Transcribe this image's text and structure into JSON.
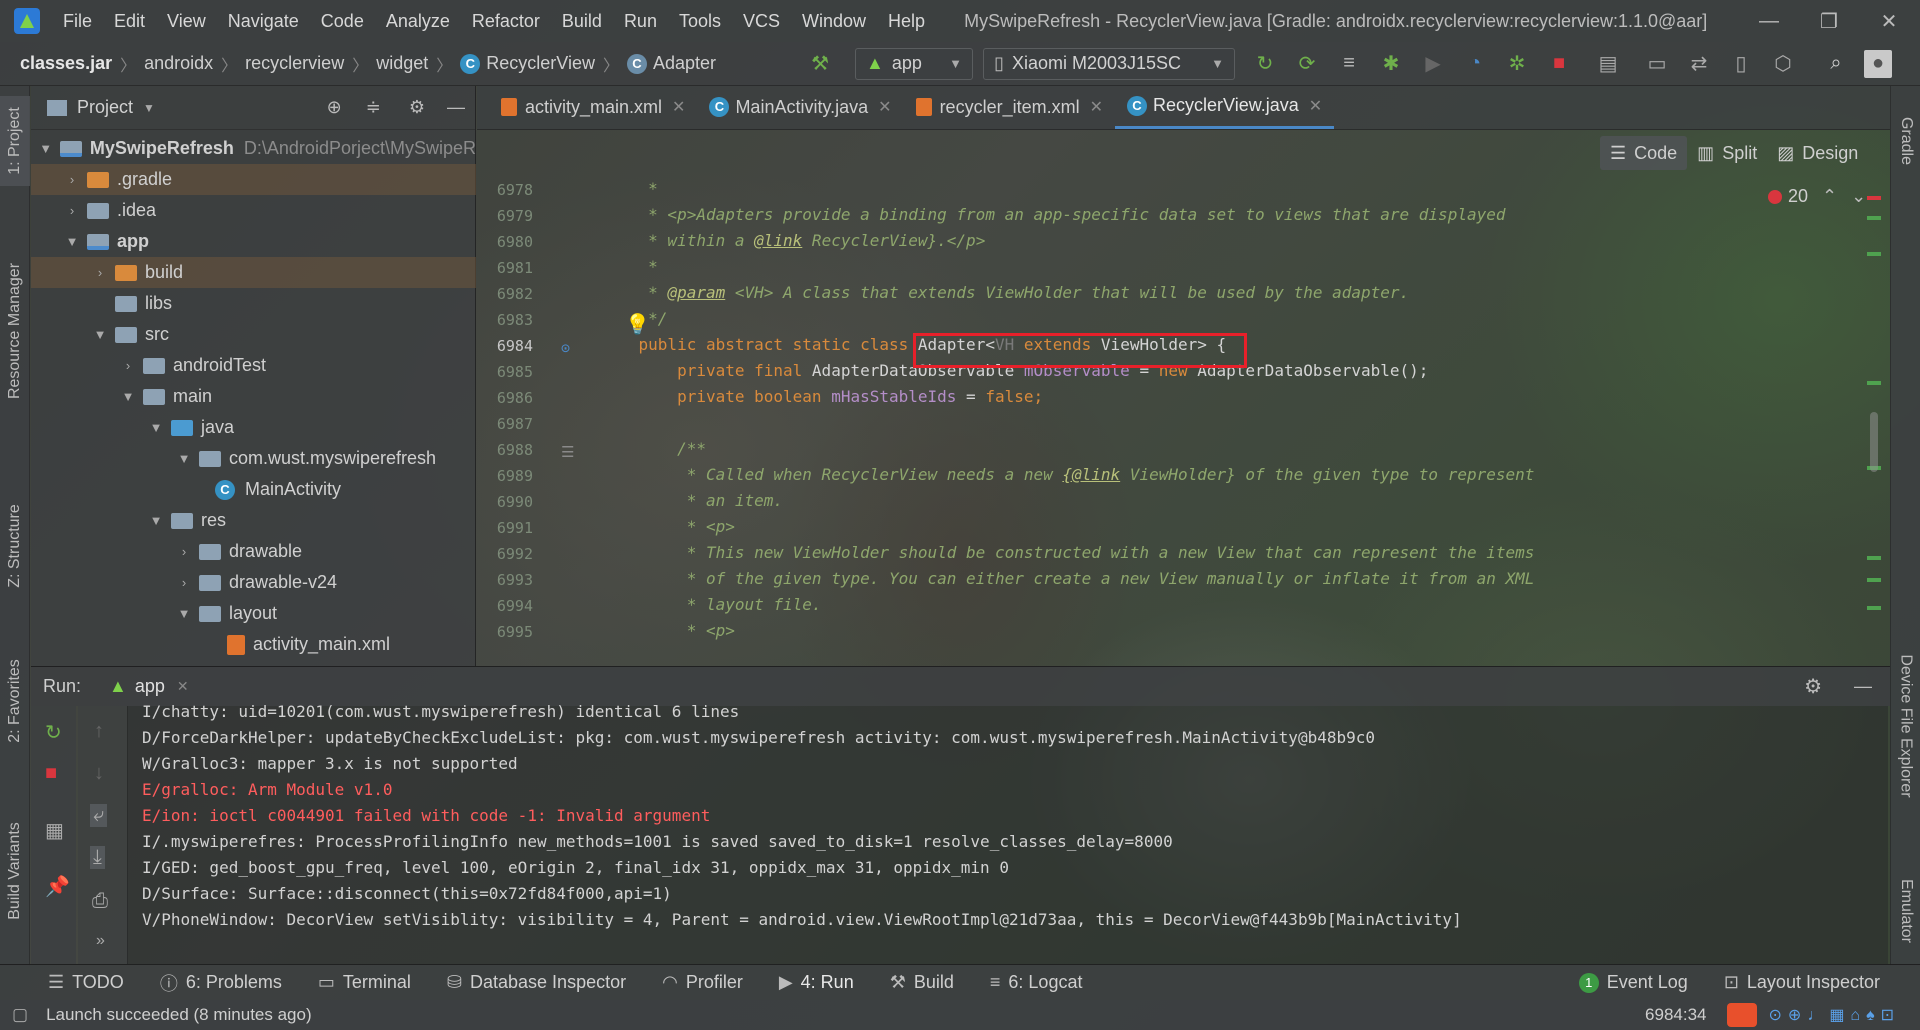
{
  "menu": [
    "File",
    "Edit",
    "View",
    "Navigate",
    "Code",
    "Analyze",
    "Refactor",
    "Build",
    "Run",
    "Tools",
    "VCS",
    "Window",
    "Help"
  ],
  "window_title": "MySwipeRefresh - RecyclerView.java [Gradle: androidx.recyclerview:recyclerview:1.1.0@aar]",
  "breadcrumb": [
    "classes.jar",
    "androidx",
    "recyclerview",
    "widget",
    "RecyclerView",
    "Adapter"
  ],
  "toolbar": {
    "run_config": "app",
    "device": "Xiaomi M2003J15SC"
  },
  "left_tabs": [
    "1: Project",
    "Resource Manager",
    "Z: Structure",
    "2: Favorites",
    "Build Variants"
  ],
  "right_tabs": [
    "Gradle",
    "Device File Explorer",
    "Emulator"
  ],
  "project": {
    "header": "Project",
    "root_name": "MySwipeRefresh",
    "root_path": "D:\\AndroidPorject\\MySwipeR",
    "items": [
      ".gradle",
      ".idea",
      "app",
      "build",
      "libs",
      "src",
      "androidTest",
      "main",
      "java",
      "com.wust.myswiperefresh",
      "MainActivity",
      "res",
      "drawable",
      "drawable-v24",
      "layout",
      "activity_main.xml"
    ]
  },
  "editor": {
    "tabs": [
      "activity_main.xml",
      "MainActivity.java",
      "recycler_item.xml",
      "RecyclerView.java"
    ],
    "modes": [
      "Code",
      "Split",
      "Design"
    ],
    "error_count": "20",
    "line_numbers": [
      "6978",
      "6979",
      "6980",
      "6981",
      "6982",
      "6983",
      "6984",
      "6985",
      "6986",
      "6987",
      "6988",
      "6989",
      "6990",
      "6991",
      "6992",
      "6993",
      "6994",
      "6995"
    ],
    "code": {
      "l6978": "     *",
      "l6979a": "     * <p>Adapters provide a binding from an app-specific data set to views that are displayed",
      "l6980a": "     * within a ",
      "l6980b": "@link",
      "l6980c": " RecyclerView}.</p>",
      "l6981": "     *",
      "l6982a": "     * ",
      "l6982b": "@param",
      "l6982c": " <VH> A class that extends ViewHolder that will be used by the adapter.",
      "l6983": "     */",
      "l6984a": "    public abstract static class ",
      "l6984b": "Adapter<",
      "l6984c": "VH",
      "l6984d": " extends ",
      "l6984e": "ViewHolder> {",
      "l6985a": "        private final ",
      "l6985b": "AdapterDataObservable ",
      "l6985c": "mObservable",
      "l6985d": " = ",
      "l6985e": "new ",
      "l6985f": "AdapterDataObservable();",
      "l6986a": "        private boolean ",
      "l6986b": "mHasStableIds",
      "l6986c": " = ",
      "l6986d": "false",
      "l6986e": ";",
      "l6988": "        /**",
      "l6989a": "         * Called when RecyclerView needs a new ",
      "l6989b": "{@link",
      "l6989c": " ViewHolder} of the given type to represent",
      "l6990": "         * an item.",
      "l6991": "         * <p>",
      "l6992": "         * This new ViewHolder should be constructed with a new View that can represent the items",
      "l6993": "         * of the given type. You can either create a new View manually or inflate it from an XML",
      "l6994": "         * layout file.",
      "l6995": "         * <p>"
    }
  },
  "run": {
    "label": "Run:",
    "tab": "app",
    "logs": [
      {
        "text": "I/chatty: uid=10201(com.wust.myswiperefresh) identical 6 lines",
        "error": false
      },
      {
        "text": "D/ForceDarkHelper: updateByCheckExcludeList: pkg: com.wust.myswiperefresh activity: com.wust.myswiperefresh.MainActivity@b48b9c0",
        "error": false
      },
      {
        "text": "W/Gralloc3: mapper 3.x is not supported",
        "error": false
      },
      {
        "text": "E/gralloc: Arm Module v1.0",
        "error": true
      },
      {
        "text": "E/ion: ioctl c0044901 failed with code -1: Invalid argument",
        "error": true
      },
      {
        "text": "I/.myswiperefres: ProcessProfilingInfo new_methods=1001 is saved saved_to_disk=1 resolve_classes_delay=8000",
        "error": false
      },
      {
        "text": "I/GED: ged_boost_gpu_freq, level 100, eOrigin 2, final_idx 31, oppidx_max 31, oppidx_min 0",
        "error": false
      },
      {
        "text": "D/Surface: Surface::disconnect(this=0x72fd84f000,api=1)",
        "error": false
      },
      {
        "text": "V/PhoneWindow: DecorView setVisiblity: visibility = 4, Parent = android.view.ViewRootImpl@21d73aa, this = DecorView@f443b9b[MainActivity]",
        "error": false
      }
    ]
  },
  "bottom_tabs": {
    "todo": "TODO",
    "problems": "6: Problems",
    "terminal": "Terminal",
    "dbinspector": "Database Inspector",
    "profiler": "Profiler",
    "run": "4: Run",
    "build": "Build",
    "logcat": "6: Logcat",
    "eventlog": "Event Log",
    "eventlog_count": "1",
    "layout": "Layout Inspector"
  },
  "status": {
    "message": "Launch succeeded (8 minutes ago)",
    "position": "6984:34"
  },
  "colors": {
    "highlight": "#e8202a",
    "accent": "#4a88c7",
    "error_text": "#ff5d5d"
  }
}
